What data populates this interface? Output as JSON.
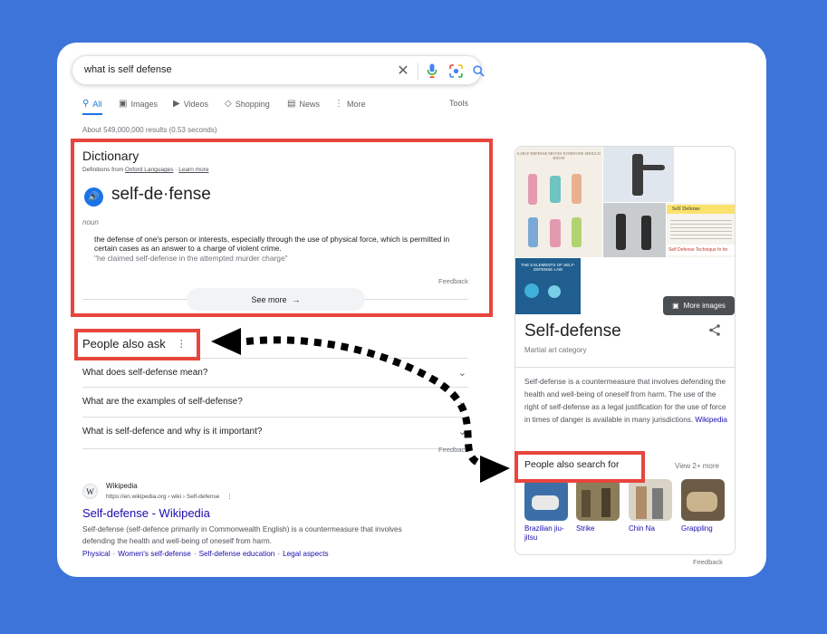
{
  "search": {
    "query": "what is self defense",
    "clear_icon": "close-icon",
    "mic_icon": "microphone-icon",
    "lens_icon": "lens-icon",
    "search_icon": "search-icon"
  },
  "tabs": [
    {
      "label": "All",
      "icon": "search-icon",
      "active": true
    },
    {
      "label": "Images",
      "icon": "image-icon"
    },
    {
      "label": "Videos",
      "icon": "play-icon"
    },
    {
      "label": "Shopping",
      "icon": "tag-icon"
    },
    {
      "label": "News",
      "icon": "newspaper-icon"
    },
    {
      "label": "More",
      "icon": "more-vertical-icon"
    }
  ],
  "tools_label": "Tools",
  "result_stats": "About 549,000,000 results (0.53 seconds)",
  "dictionary": {
    "title": "Dictionary",
    "source_prefix": "Definitions from",
    "source_link": "Oxford Languages",
    "source_sep": "·",
    "learn_more": "Learn more",
    "word": "self-de·fense",
    "part_of_speech": "noun",
    "definition": "the defense of one's person or interests, especially through the use of physical force, which is permitted in certain cases as an answer to a charge of violent crime.",
    "example": "\"he claimed self-defense in the attempted murder charge\"",
    "feedback": "Feedback",
    "see_more": "See more",
    "see_more_arrow": "→"
  },
  "people_also_ask": {
    "title": "People also ask",
    "menu": "⋮",
    "questions": [
      "What does self-defense mean?",
      "What are the examples of self-defense?",
      "What is self-defence and why is it important?"
    ],
    "chevron": "⌄",
    "feedback": "Feedback"
  },
  "wiki_result": {
    "favicon": "W",
    "site": "Wikipedia",
    "url": "https://en.wikipedia.org › wiki › Self-defense",
    "menu": "⋮",
    "title": "Self-defense - Wikipedia",
    "snippet": "Self-defense (self-defence primarily in Commonwealth English) is a countermeasure that involves defending the health and well-being of oneself from harm.",
    "links": [
      "Physical",
      "Women's self-defense",
      "Self-defense education",
      "Legal aspects"
    ]
  },
  "knowledge_panel": {
    "poster_text": "6 SELF DEFENSE MOVES EVERYONE SHOULD KNOW",
    "law_text": "THE 5 ELEMENTS OF SELF-DEFENSE LAW",
    "article_heading": "Self Defense",
    "article_caption": "Self Defense Technique fo Im",
    "more_images": "More images",
    "title": "Self-defense",
    "share_icon": "share-icon",
    "subtitle": "Martial art category",
    "description": "Self-defense is a countermeasure that involves defending the health and well-being of oneself from harm. The use of the right of self-defense as a legal justification for the use of force in times of danger is available in many jurisdictions.",
    "description_link": "Wikipedia",
    "pasf_title": "People also search for",
    "pasf_more": "View 2+ more",
    "pasf_items": [
      {
        "label": "Brazilian jiu-jitsu",
        "thumb": "brazilian-jiu-jitsu-thumbnail"
      },
      {
        "label": "Strike",
        "thumb": "strike-thumbnail"
      },
      {
        "label": "Chin Na",
        "thumb": "chin-na-thumbnail"
      },
      {
        "label": "Grappling",
        "thumb": "grappling-thumbnail"
      }
    ],
    "feedback": "Feedback"
  },
  "colors": {
    "background": "#3d74d9",
    "highlight": "#e8453c",
    "link": "#1a0dab",
    "accent": "#1a73e8"
  }
}
